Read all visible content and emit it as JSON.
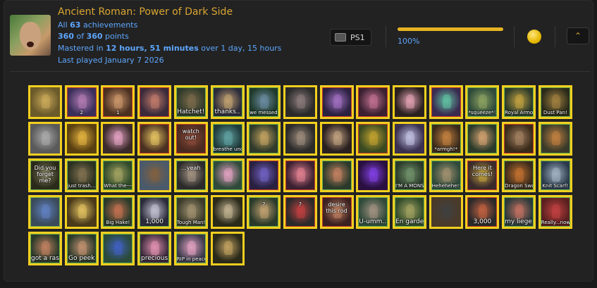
{
  "game": {
    "title": "Ancient Roman: Power of Dark Side",
    "achievements_prefix": "All ",
    "achievements_count": "63",
    "achievements_suffix": " achievements",
    "points_earned": "360",
    "points_of": " of ",
    "points_total": "360",
    "points_suffix": " points",
    "mastered_prefix": "Mastered in ",
    "mastered_time": "12 hours, 51 minutes",
    "mastered_suffix": " over 1 day, 15 hours",
    "last_played": "Last played January 7 2026",
    "console": "PS1",
    "progress_percent_label": "100%",
    "progress_fraction": 1.0
  },
  "colors": {
    "accent": "#d9a632",
    "link": "#5ea7ff",
    "badge_border": "#f2cf1f",
    "progress": "#e6b422"
  },
  "icons": {
    "console": "playstation-icon",
    "medal": "mastery-medal-icon",
    "collapse": "chevron-up-icon"
  },
  "badges": [
    {
      "caption": "",
      "bg": "#6b5a2a",
      "fg": "#c9a95a"
    },
    {
      "caption": "2",
      "bg": "#3a2f5a",
      "fg": "#b07ab0",
      "frame": "red"
    },
    {
      "caption": "1",
      "bg": "#4a3020",
      "fg": "#c9956a",
      "frame": "red"
    },
    {
      "caption": "",
      "bg": "#3a2a3a",
      "fg": "#c07a6a",
      "frame": "red"
    },
    {
      "caption": "Hatchet!",
      "bg": "#2f3a2a",
      "fg": "#7a6a4a",
      "frame": "grn",
      "big": true
    },
    {
      "caption": "thanks..",
      "bg": "#2a2a3a",
      "fg": "#c0a070",
      "frame": "grn",
      "big": true
    },
    {
      "caption": "we messed up",
      "bg": "#1f3a2a",
      "fg": "#6a8aa0",
      "frame": "grn"
    },
    {
      "caption": "",
      "bg": "#2a2a2a",
      "fg": "#8a7a7a"
    },
    {
      "caption": "",
      "bg": "#2a2040",
      "fg": "#a070c0",
      "frame": "red"
    },
    {
      "caption": "",
      "bg": "#3a2030",
      "fg": "#c07090",
      "frame": "red"
    },
    {
      "caption": "",
      "bg": "#2a2020",
      "fg": "#e0a0b0"
    },
    {
      "caption": "",
      "bg": "#3a2a50",
      "fg": "#60c0a0",
      "frame": "red"
    },
    {
      "caption": "*squeeze*♡",
      "bg": "#2f4a3a",
      "fg": "#8aa060",
      "frame": "grn"
    },
    {
      "caption": "Royal Armor!",
      "bg": "#2a3a2a",
      "fg": "#c0a040",
      "frame": "grn"
    },
    {
      "caption": "Dust Pan!",
      "bg": "#2a2a1a",
      "fg": "#a08040",
      "frame": "grn"
    },
    {
      "caption": "",
      "bg": "#5a5a5a",
      "fg": "#aaaaaa"
    },
    {
      "caption": "",
      "bg": "#5a4010",
      "fg": "#e0b040"
    },
    {
      "caption": "",
      "bg": "#3a2a2a",
      "fg": "#e0a0c0"
    },
    {
      "caption": "",
      "bg": "#4a3020",
      "fg": "#e0c060",
      "frame": "red"
    },
    {
      "caption": "watch out!",
      "bg": "#4a2a20",
      "fg": "#8a4a3a",
      "frame": "red",
      "mid": true
    },
    {
      "caption": "breathe underwater",
      "bg": "#1f3a3a",
      "fg": "#60a0a0",
      "frame": "grn"
    },
    {
      "caption": "",
      "bg": "#2f3a2a",
      "fg": "#c0a060",
      "frame": "grn"
    },
    {
      "caption": "",
      "bg": "#2a2a2a",
      "fg": "#9a8a7a"
    },
    {
      "caption": "",
      "bg": "#2a2020",
      "fg": "#c0a080"
    },
    {
      "caption": "",
      "bg": "#3a4a20",
      "fg": "#c0a030",
      "frame": "red"
    },
    {
      "caption": "",
      "bg": "#3a3050",
      "fg": "#c0c0e0"
    },
    {
      "caption": "*armgh!*",
      "bg": "#3a2a1a",
      "fg": "#c08040",
      "frame": "grn"
    },
    {
      "caption": "",
      "bg": "#2a3a2a",
      "fg": "#d0a070",
      "frame": "grn"
    },
    {
      "caption": "",
      "bg": "#3a2a1a",
      "fg": "#a08060",
      "frame": "red"
    },
    {
      "caption": "",
      "bg": "#3a3a2a",
      "fg": "#c08040",
      "frame": "grn"
    },
    {
      "caption": "Did you forget me?",
      "bg": "#2a2a1a",
      "fg": "#808060",
      "frame": "grn",
      "mid": true
    },
    {
      "caption": "just trash...",
      "bg": "#2a3020",
      "fg": "#807050",
      "frame": "grn"
    },
    {
      "caption": "What the---?",
      "bg": "#2f4a2a",
      "fg": "#a0a060",
      "frame": "grn"
    },
    {
      "caption": "",
      "bg": "#4a5a6a",
      "fg": "#806040"
    },
    {
      "caption": "...yeah",
      "bg": "#2a2a2a",
      "fg": "#a09080",
      "frame": "grn",
      "mid": true
    },
    {
      "caption": "♡",
      "bg": "#2f4a3a",
      "fg": "#e0a0c0",
      "frame": "grn",
      "mid": true
    },
    {
      "caption": "",
      "bg": "#2a2040",
      "fg": "#7060c0",
      "frame": "red"
    },
    {
      "caption": "",
      "bg": "#3a2030",
      "fg": "#e08090",
      "frame": "red"
    },
    {
      "caption": "",
      "bg": "#2a3a2a",
      "fg": "#c08060",
      "frame": "grn"
    },
    {
      "caption": "",
      "bg": "#2a1040",
      "fg": "#8040e0"
    },
    {
      "caption": "I'M A MONSTER!",
      "bg": "#2a3a2a",
      "fg": "#70906a",
      "frame": "grn"
    },
    {
      "caption": "Hehehehe!♡",
      "bg": "#2f4a3a",
      "fg": "#a09070",
      "frame": "grn"
    },
    {
      "caption": "Here it comes!",
      "bg": "#3a2a2a",
      "fg": "#c0a040",
      "frame": "red",
      "mid": true
    },
    {
      "caption": "Dragon Sword!",
      "bg": "#3a2a1a",
      "fg": "#c07030",
      "frame": "grn"
    },
    {
      "caption": "Knit Scarf!",
      "bg": "#2a3a4a",
      "fg": "#a0b0c0",
      "frame": "grn"
    },
    {
      "caption": "",
      "bg": "#3a4a5a",
      "fg": "#6080c0",
      "frame": "grn"
    },
    {
      "caption": "",
      "bg": "#4a3a1a",
      "fg": "#e0c060"
    },
    {
      "caption": "Big Hake!",
      "bg": "#2a3a2a",
      "fg": "#c07050",
      "frame": "grn"
    },
    {
      "caption": "1,000",
      "bg": "#2a2a3a",
      "fg": "#c0c0d0",
      "frame": "grn",
      "big": true
    },
    {
      "caption": "Tough Man!",
      "bg": "#3a3a2a",
      "fg": "#a09070",
      "frame": "grn"
    },
    {
      "caption": "",
      "bg": "#2a2a1a",
      "fg": "#c0b090"
    },
    {
      "caption": "?",
      "bg": "#2a3a2a",
      "fg": "#c0a070",
      "frame": "grn",
      "mid": true
    },
    {
      "caption": "?",
      "bg": "#2a2a2a",
      "fg": "#c04040",
      "frame": "red",
      "mid": true
    },
    {
      "caption": "desire this rod",
      "bg": "#3a2020",
      "fg": "#c08060",
      "frame": "red",
      "mid": true
    },
    {
      "caption": "U-umm...",
      "bg": "#2f4a3a",
      "fg": "#a09080",
      "frame": "grn",
      "big": true
    },
    {
      "caption": "En garde!",
      "bg": "#2f4a2a",
      "fg": "#a0a060",
      "frame": "grn",
      "big": true
    },
    {
      "caption": "",
      "bg": "#4a3a2a",
      "fg": "#404040"
    },
    {
      "caption": "3,000",
      "bg": "#2a2a2a",
      "fg": "#c06040",
      "frame": "red",
      "big": true
    },
    {
      "caption": "my liege...",
      "bg": "#2a3a3a",
      "fg": "#c07060",
      "frame": "grn",
      "big": true
    },
    {
      "caption": "Really...now...",
      "bg": "#5a2020",
      "fg": "#c04040",
      "frame": "grn"
    },
    {
      "caption": "got a rash",
      "bg": "#2a3a2a",
      "fg": "#c08060",
      "frame": "grn",
      "big": true
    },
    {
      "caption": "Go peek",
      "bg": "#2a3a2a",
      "fg": "#c09070",
      "frame": "grn",
      "big": true
    },
    {
      "caption": "",
      "bg": "#2a4a3a",
      "fg": "#4060c0",
      "frame": "grn"
    },
    {
      "caption": "precious",
      "bg": "#3a2a3a",
      "fg": "#e090b0",
      "frame": "grn",
      "big": true
    },
    {
      "caption": "RIP in peace!",
      "bg": "#3a3a4a",
      "fg": "#e0a0c0",
      "frame": "grn"
    },
    {
      "caption": "",
      "bg": "#2a2a1a",
      "fg": "#c0a060"
    }
  ]
}
